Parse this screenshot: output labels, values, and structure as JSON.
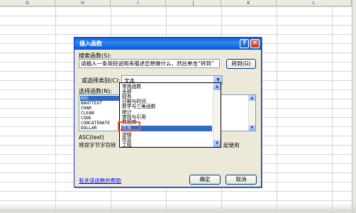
{
  "columns": [
    "G",
    "H",
    "I",
    "J",
    "K",
    "L"
  ],
  "dialog": {
    "title": "插入函数",
    "help_glyph": "?",
    "close_glyph": "✕",
    "search_label": "搜索函数(S):",
    "search_value": "请输入一条简短说明来描述您想做什么，然后单击“转到”",
    "goto_button": "转到(G)",
    "category_label": "或选择类别(C):",
    "category_value": "文本",
    "function_label": "选择函数(N):",
    "functions": [
      "ASC",
      "BAHTTEXT",
      "CHAR",
      "CLEAN",
      "CODE",
      "CONCATENATE",
      "DOLLAR"
    ],
    "selected_function": "ASC",
    "description_signature": "ASC(text)",
    "description_text": "将双字节字符转",
    "description_tail": "起使用",
    "help_link": "有关该函数的帮助",
    "ok_button": "确定",
    "cancel_button": "取消"
  },
  "category_dropdown": {
    "items": [
      "常用函数",
      "全部",
      "财务",
      "日期与时间",
      "数学与三角函数",
      "统计",
      "查找与引用",
      "数据库",
      "文本",
      "逻辑",
      "信息",
      "工程"
    ],
    "selected": "文本"
  },
  "colors": {
    "titlebar": "#0a5fd8",
    "selection": "#316ac5",
    "highlight_box": "#e8603c",
    "dialog_bg": "#ece9d8"
  }
}
